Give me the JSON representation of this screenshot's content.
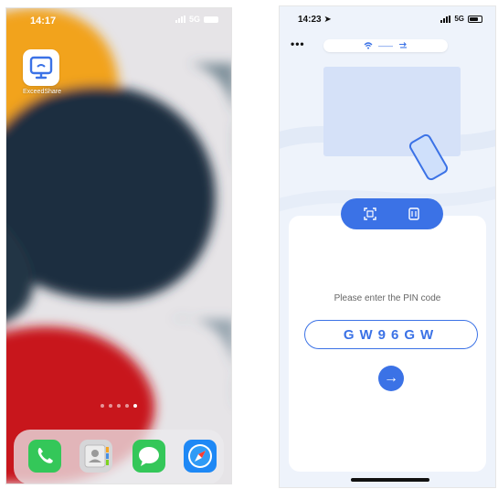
{
  "left_phone": {
    "status": {
      "time": "14:17",
      "network": "5G"
    },
    "app": {
      "label": "ExceedShare",
      "icon": "screen-share-icon"
    },
    "page_dots": {
      "count": 5,
      "active_index": 4
    },
    "dock": [
      {
        "name": "phone-app-icon",
        "color": "#34c759"
      },
      {
        "name": "contacts-app-icon",
        "color": "#d8d8d8"
      },
      {
        "name": "messages-app-icon",
        "color": "#34c759"
      },
      {
        "name": "safari-app-icon",
        "color": "#1e88f5"
      }
    ]
  },
  "right_phone": {
    "status": {
      "time": "14:23",
      "network": "5G"
    },
    "more_label": "•••",
    "wifi_name": "——",
    "tabs": [
      {
        "name": "scan-qr-tab",
        "icon": "qr-scan-icon"
      },
      {
        "name": "pin-tab",
        "icon": "pin-icon"
      }
    ],
    "pin_prompt": "Please enter the PIN code",
    "pin_code": "GW96GW",
    "go_label": "→",
    "accent": "#3b72e6"
  }
}
